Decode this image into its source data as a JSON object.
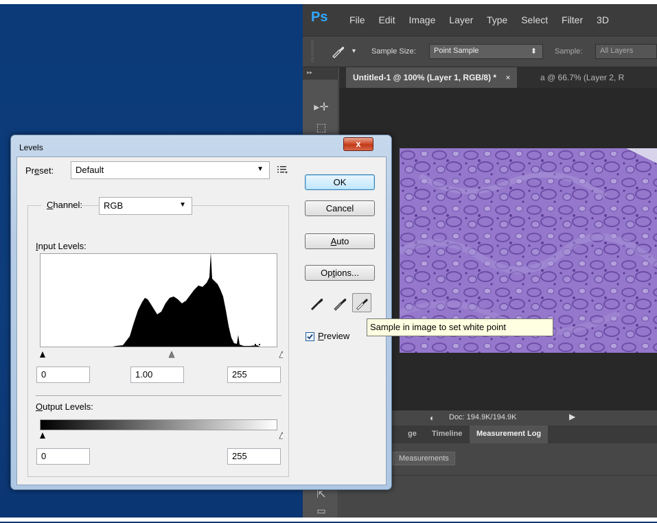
{
  "ps": {
    "logo": "Ps",
    "menus": [
      "File",
      "Edit",
      "Image",
      "Layer",
      "Type",
      "Select",
      "Filter",
      "3D"
    ],
    "options": {
      "sample_size_label": "Sample Size:",
      "sample_size_value": "Point Sample",
      "sample_label": "Sample:",
      "sample_value": "All Layers"
    },
    "tabs": [
      {
        "label": "Untitled-1 @ 100% (Layer 1, RGB/8) *",
        "close": "×"
      },
      {
        "label": "a @ 66.7% (Layer 2, R"
      }
    ],
    "status": {
      "doc": "Doc: 194.9K/194.9K"
    },
    "panel_tabs": [
      "ge",
      "Timeline",
      "Measurement Log"
    ],
    "panel_button": "Measurements"
  },
  "levels": {
    "title": "Levels",
    "close": "x",
    "preset_label_pre": "Pr",
    "preset_label_u": "e",
    "preset_label_post": "set:",
    "preset_value": "Default",
    "channel_label_u": "C",
    "channel_label_post": "hannel:",
    "channel_value": "RGB",
    "input_levels_u": "I",
    "input_levels_post": "nput Levels:",
    "input_black": "0",
    "input_gamma": "1.00",
    "input_white": "255",
    "output_levels_u": "O",
    "output_levels_post": "utput Levels:",
    "output_black": "0",
    "output_white": "255",
    "buttons": {
      "ok": "OK",
      "cancel": "Cancel",
      "auto_u": "A",
      "auto_post": "uto",
      "options_pre": "Op",
      "options_u": "t",
      "options_post": "ions..."
    },
    "preview_u": "P",
    "preview_post": "review",
    "preview_checked": true,
    "tooltip": "Sample in image to set white point"
  },
  "colors": {
    "desktop": "#0e3b78",
    "ps_accent": "#31a8ff",
    "image": "#8f71c7"
  }
}
